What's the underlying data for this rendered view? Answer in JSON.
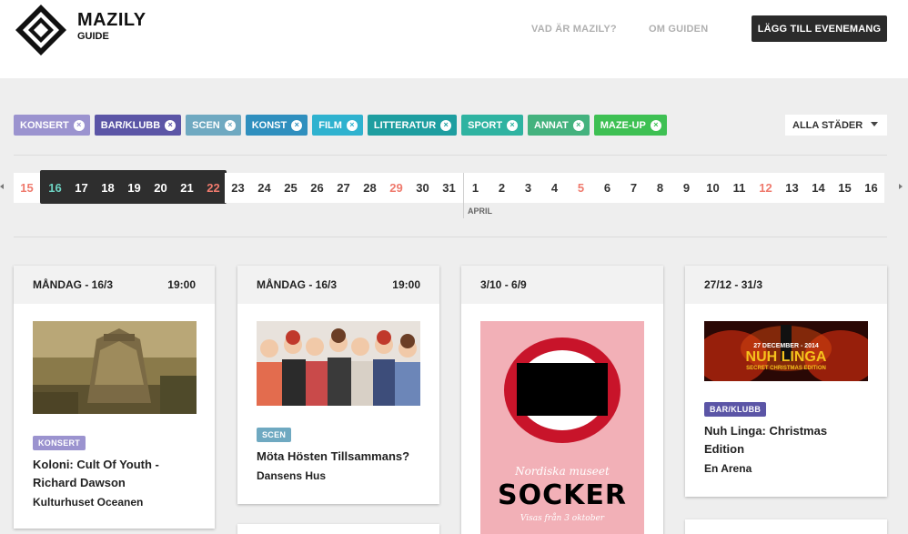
{
  "brand": {
    "name": "MAZILY",
    "sub": "GUIDE"
  },
  "nav": {
    "about": "VAD ÄR MAZILY?",
    "guide": "OM GUIDEN",
    "add_event": "LÄGG TILL EVENEMANG"
  },
  "filters": [
    {
      "label": "KONSERT",
      "color": "#9b93cf"
    },
    {
      "label": "BAR/KLUBB",
      "color": "#5b55a6"
    },
    {
      "label": "SCEN",
      "color": "#6fa9c1"
    },
    {
      "label": "KONST",
      "color": "#2f8fbe"
    },
    {
      "label": "FILM",
      "color": "#2fb2cf"
    },
    {
      "label": "LITTERATUR",
      "color": "#1e9ea0"
    },
    {
      "label": "SPORT",
      "color": "#2fb3a1"
    },
    {
      "label": "ANNAT",
      "color": "#44b27e"
    },
    {
      "label": "MAZE-UP",
      "color": "#3ec053"
    }
  ],
  "filter_remove_glyph": "×",
  "city_select": {
    "value": "ALLA STÄDER"
  },
  "days": [
    "15",
    "16",
    "17",
    "18",
    "19",
    "20",
    "21",
    "22",
    "23",
    "24",
    "25",
    "26",
    "27",
    "28",
    "29",
    "30",
    "31",
    "1",
    "2",
    "3",
    "4",
    "5",
    "6",
    "7",
    "8",
    "9",
    "10",
    "11",
    "12",
    "13",
    "14",
    "15",
    "16"
  ],
  "weekend_days": [
    "15",
    "22",
    "29",
    "5",
    "12"
  ],
  "selected_range": [
    "16",
    "17",
    "18",
    "19",
    "20",
    "21",
    "22"
  ],
  "month_label": "APRIL",
  "cards": [
    {
      "date": "MÅNDAG - 16/3",
      "time": "19:00",
      "tag": "KONSERT",
      "tag_color": "#9b93cf",
      "title": "Koloni: Cult Of Youth - Richard Dawson",
      "venue": "Kulturhuset Oceanen"
    },
    {
      "date": "MÅNDAG - 16/3",
      "time": "19:00",
      "tag": "SCEN",
      "tag_color": "#6fa9c1",
      "title": "Möta Hösten Tillsammans?",
      "venue": "Dansens Hus"
    },
    {
      "date": "3/10 - 6/9",
      "time": "",
      "poster_script": "Nordiska museet",
      "poster_title": "SOCKER",
      "poster_sub": "Visas från 3 oktober"
    },
    {
      "date": "27/12 - 31/3",
      "time": "",
      "tag": "BAR/KLUBB",
      "tag_color": "#5b55a6",
      "title": "Nuh Linga: Christmas Edition",
      "venue": "En Arena",
      "banner_date": "27 DECEMBER - 2014",
      "banner_title": "NUH LINGA",
      "banner_sub": "SECRET CHRISTMAS EDITION"
    }
  ]
}
